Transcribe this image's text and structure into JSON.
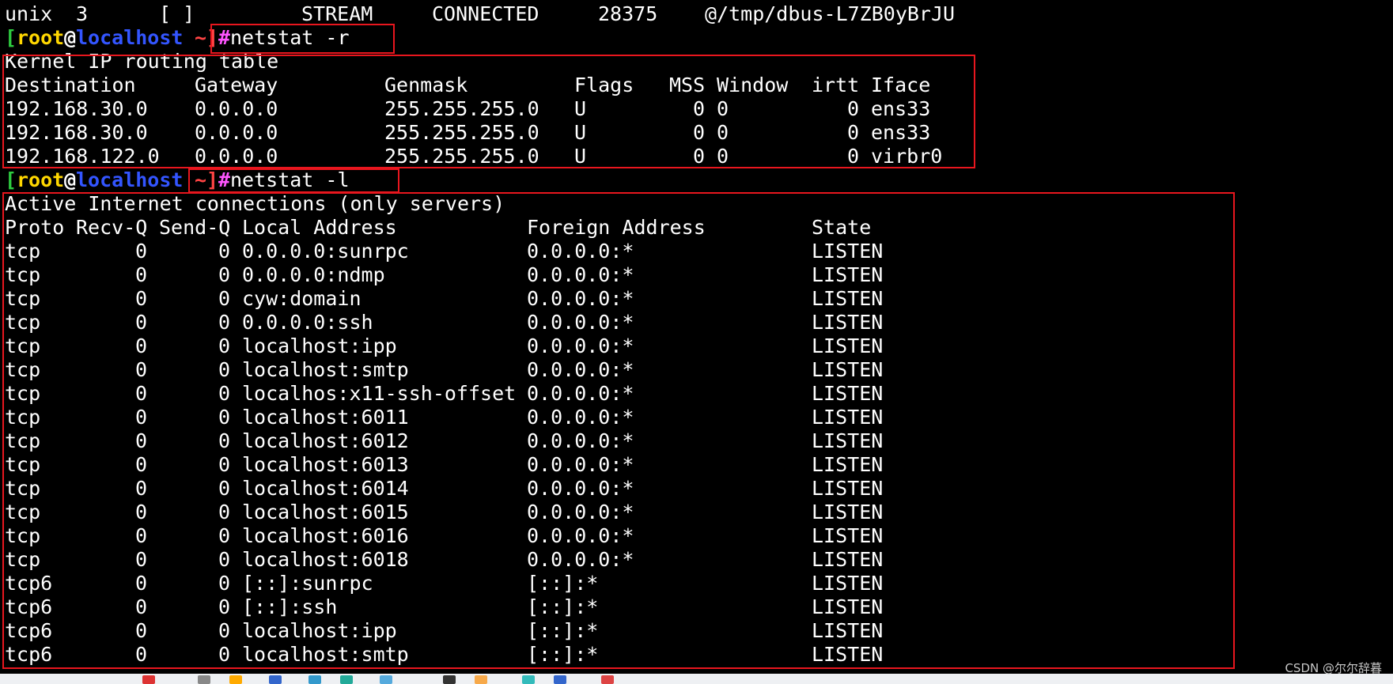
{
  "colors": {
    "background": "#000000",
    "text": "#ffffff",
    "bracket": "#2ecc40",
    "user": "#ffd700",
    "host": "#3355ff",
    "cwd": "#ff4444",
    "hash": "#ff55ff",
    "command": "#ffffff",
    "highlight_box": "#e8161e"
  },
  "top_line": [
    "unix",
    "3",
    "[ ]",
    "STREAM",
    "CONNECTED",
    "28375",
    "@/tmp/dbus-L7ZB0yBrJU"
  ],
  "prompt": {
    "open": "[",
    "user": "root",
    "at": "@",
    "host": "localhost",
    "cwd": " ~",
    "close": "]",
    "hash": "#"
  },
  "commands": {
    "route": "netstat -r",
    "listen": "netstat -l"
  },
  "routing": {
    "title": "Kernel IP routing table",
    "headers": [
      "Destination",
      "Gateway",
      "Genmask",
      "Flags",
      "MSS",
      "Window",
      "irtt",
      "Iface"
    ],
    "rows": [
      [
        "192.168.30.0",
        "0.0.0.0",
        "255.255.255.0",
        "U",
        "0",
        "0",
        "0",
        "ens33"
      ],
      [
        "192.168.30.0",
        "0.0.0.0",
        "255.255.255.0",
        "U",
        "0",
        "0",
        "0",
        "ens33"
      ],
      [
        "192.168.122.0",
        "0.0.0.0",
        "255.255.255.0",
        "U",
        "0",
        "0",
        "0",
        "virbr0"
      ]
    ]
  },
  "connections": {
    "title": "Active Internet connections (only servers)",
    "headers": [
      "Proto",
      "Recv-Q",
      "Send-Q",
      "Local Address",
      "Foreign Address",
      "State"
    ],
    "rows": [
      [
        "tcp",
        "0",
        "0",
        "0.0.0.0:sunrpc",
        "0.0.0.0:*",
        "LISTEN"
      ],
      [
        "tcp",
        "0",
        "0",
        "0.0.0.0:ndmp",
        "0.0.0.0:*",
        "LISTEN"
      ],
      [
        "tcp",
        "0",
        "0",
        "cyw:domain",
        "0.0.0.0:*",
        "LISTEN"
      ],
      [
        "tcp",
        "0",
        "0",
        "0.0.0.0:ssh",
        "0.0.0.0:*",
        "LISTEN"
      ],
      [
        "tcp",
        "0",
        "0",
        "localhost:ipp",
        "0.0.0.0:*",
        "LISTEN"
      ],
      [
        "tcp",
        "0",
        "0",
        "localhost:smtp",
        "0.0.0.0:*",
        "LISTEN"
      ],
      [
        "tcp",
        "0",
        "0",
        "localhos:x11-ssh-offset",
        "0.0.0.0:*",
        "LISTEN"
      ],
      [
        "tcp",
        "0",
        "0",
        "localhost:6011",
        "0.0.0.0:*",
        "LISTEN"
      ],
      [
        "tcp",
        "0",
        "0",
        "localhost:6012",
        "0.0.0.0:*",
        "LISTEN"
      ],
      [
        "tcp",
        "0",
        "0",
        "localhost:6013",
        "0.0.0.0:*",
        "LISTEN"
      ],
      [
        "tcp",
        "0",
        "0",
        "localhost:6014",
        "0.0.0.0:*",
        "LISTEN"
      ],
      [
        "tcp",
        "0",
        "0",
        "localhost:6015",
        "0.0.0.0:*",
        "LISTEN"
      ],
      [
        "tcp",
        "0",
        "0",
        "localhost:6016",
        "0.0.0.0:*",
        "LISTEN"
      ],
      [
        "tcp",
        "0",
        "0",
        "localhost:6018",
        "0.0.0.0:*",
        "LISTEN"
      ],
      [
        "tcp6",
        "0",
        "0",
        "[::]:sunrpc",
        "[::]:*",
        "LISTEN"
      ],
      [
        "tcp6",
        "0",
        "0",
        "[::]:ssh",
        "[::]:*",
        "LISTEN"
      ],
      [
        "tcp6",
        "0",
        "0",
        "localhost:ipp",
        "[::]:*",
        "LISTEN"
      ],
      [
        "tcp6",
        "0",
        "0",
        "localhost:smtp",
        "[::]:*",
        "LISTEN"
      ]
    ]
  },
  "watermark": "CSDN @尔尔辞暮",
  "taskbar_icons": [
    "app-icon-1",
    "app-icon-2",
    "app-icon-3",
    "app-icon-4",
    "app-icon-5",
    "app-icon-6",
    "app-icon-7",
    "app-icon-8",
    "app-icon-9",
    "app-icon-10",
    "app-icon-11",
    "app-icon-12"
  ]
}
